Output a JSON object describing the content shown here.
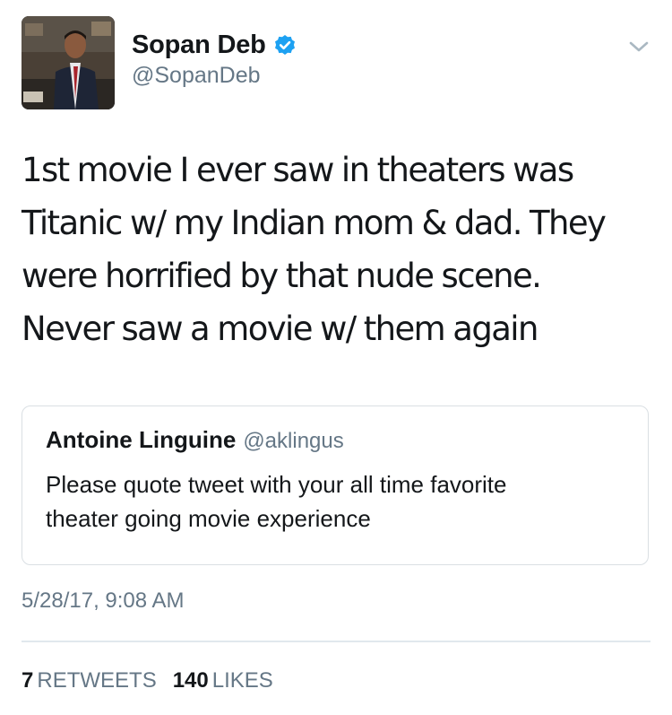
{
  "author": {
    "display_name": "Sopan Deb",
    "handle": "@SopanDeb",
    "verified": true,
    "avatar_icon": "profile-photo"
  },
  "tweet": {
    "lines": [
      "1st movie I ever saw in theaters was",
      "Titanic w/ my Indian mom & dad. They",
      "were horrified by that nude scene.",
      "Never saw a movie w/ them again"
    ],
    "timestamp": "5/28/17, 9:08 AM"
  },
  "quoted_tweet": {
    "display_name": "Antoine Linguine",
    "handle": "@aklingus",
    "lines": [
      "Please quote tweet with your all time favorite",
      "theater going movie experience"
    ]
  },
  "stats": {
    "retweets_count": "7",
    "retweets_label": "RETWEETS",
    "likes_count": "140",
    "likes_label": "LIKES"
  },
  "colors": {
    "text_primary": "#14171a",
    "text_secondary": "#657786",
    "verified_blue": "#1da1f2",
    "border": "#dadfe3"
  }
}
